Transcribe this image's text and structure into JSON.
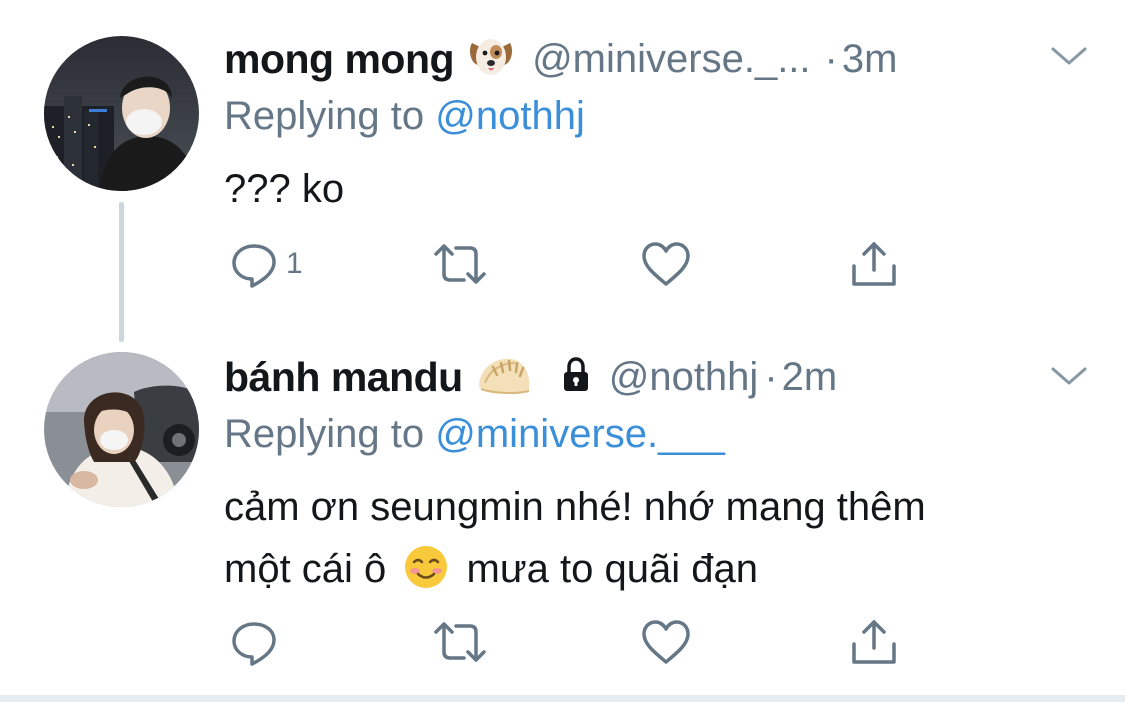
{
  "tweets": [
    {
      "display_name": "mong mong",
      "name_emoji": "dog-face-emoji",
      "handle": "@miniverse._...",
      "separator": "·",
      "time": "3m",
      "replying_prefix": "Replying to",
      "replying_to": "@nothhj",
      "text_lines": [
        "??? ko"
      ],
      "reply_count": "1",
      "retweet_count": "",
      "like_count": ""
    },
    {
      "display_name": "bánh mandu",
      "name_emoji": "dumpling-emoji",
      "protected": true,
      "handle": "@nothhj",
      "separator": "·",
      "time": "2m",
      "replying_prefix": "Replying to",
      "replying_to": "@miniverse.___",
      "text_lines": [
        "cảm ơn seungmin nhé! nhớ mang thêm",
        "một cái ô",
        "mưa to quãi đạn"
      ],
      "inline_emoji": "smiling-face-emoji",
      "reply_count": "",
      "retweet_count": "",
      "like_count": ""
    }
  ],
  "colors": {
    "text": "#14171a",
    "secondary": "#657786",
    "link": "#3b8fd9",
    "thread_line": "#ccd6dd"
  },
  "icons": [
    "reply-icon",
    "retweet-icon",
    "like-icon",
    "share-icon",
    "chevron-down-icon",
    "lock-icon"
  ]
}
